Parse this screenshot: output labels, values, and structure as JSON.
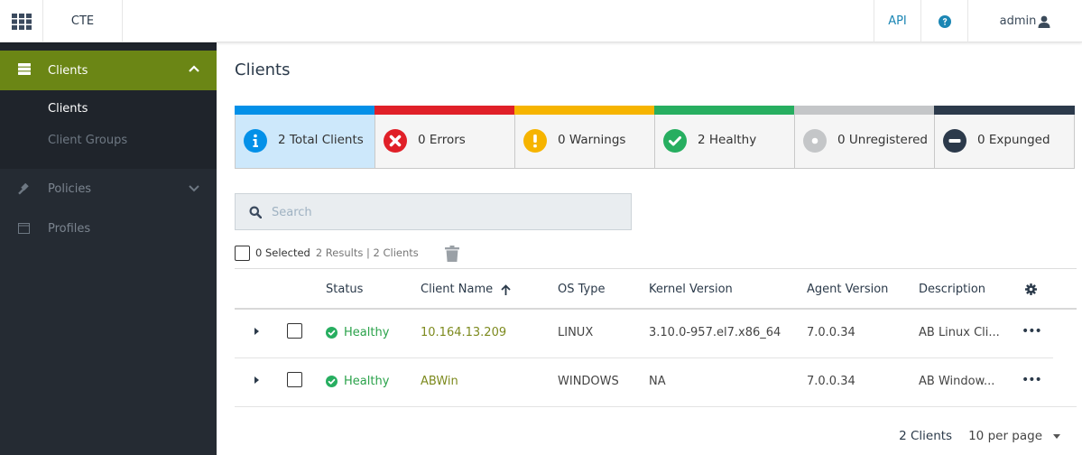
{
  "topbar": {
    "app_name": "CTE",
    "api_label": "API",
    "user_label": "admin"
  },
  "sidebar": {
    "active_section": "Clients",
    "sub_items": [
      {
        "label": "Clients",
        "current": true
      },
      {
        "label": "Client Groups",
        "current": false
      }
    ],
    "items": [
      {
        "label": "Policies",
        "icon": "gavel-icon"
      },
      {
        "label": "Profiles",
        "icon": "window-icon"
      }
    ]
  },
  "main": {
    "title": "Clients",
    "cards": [
      {
        "label": "2 Total Clients",
        "color": "#0390e8",
        "icon": "info-icon"
      },
      {
        "label": "0 Errors",
        "color": "#e02028",
        "icon": "error-icon"
      },
      {
        "label": "0 Warnings",
        "color": "#f6b400",
        "icon": "warning-icon"
      },
      {
        "label": "2 Healthy",
        "color": "#27ae60",
        "icon": "check-icon"
      },
      {
        "label": "0 Unregistered",
        "color": "#c4c6c8",
        "icon": "unregistered-icon"
      },
      {
        "label": "0 Expunged",
        "color": "#2c3a4b",
        "icon": "expunged-icon"
      }
    ],
    "search": {
      "placeholder": "Search",
      "value": ""
    },
    "selection": {
      "selected": "0 Selected",
      "results": "2 Results | 2 Clients"
    },
    "table": {
      "columns": [
        "Status",
        "Client Name",
        "OS Type",
        "Kernel Version",
        "Agent Version",
        "Description"
      ],
      "sort_column": "Client Name",
      "sort_direction": "ascending",
      "rows": [
        {
          "status": "Healthy",
          "client_name": "10.164.13.209",
          "os_type": "LINUX",
          "kernel_version": "3.10.0-957.el7.x86_64",
          "agent_version": "7.0.0.34",
          "description": "AB Linux Cli..."
        },
        {
          "status": "Healthy",
          "client_name": "ABWin",
          "os_type": "WINDOWS",
          "kernel_version": "NA",
          "agent_version": "7.0.0.34",
          "description": "AB Window..."
        }
      ]
    },
    "footer": {
      "count": "2 Clients",
      "per_page": "10 per page"
    }
  }
}
